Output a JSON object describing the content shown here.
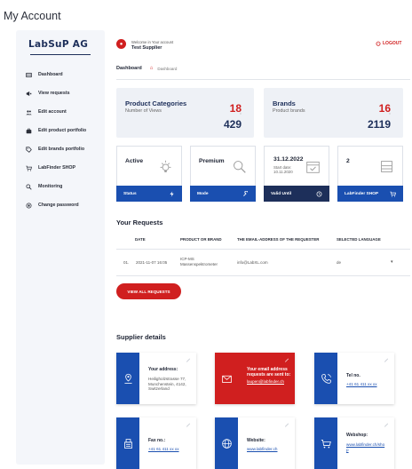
{
  "page": {
    "title": "My Account"
  },
  "brand": {
    "name": "LabSuP AG"
  },
  "sidebar": {
    "items": [
      {
        "label": "Dashboard",
        "icon": "dashboard-icon"
      },
      {
        "label": "View requests",
        "icon": "megaphone-icon"
      },
      {
        "label": "Edit account",
        "icon": "users-icon"
      },
      {
        "label": "Edit product portfolio",
        "icon": "briefcase-icon"
      },
      {
        "label": "Edit brands portfolio",
        "icon": "tag-icon"
      },
      {
        "label": "LabFinder SHOP",
        "icon": "cart-icon"
      },
      {
        "label": "Monitoring",
        "icon": "magnifier-icon"
      },
      {
        "label": "Change password",
        "icon": "key-icon"
      }
    ]
  },
  "header": {
    "welcome": "Welcome in Your account",
    "user": "Test Supplier",
    "logout": "LOGOUT"
  },
  "breadcrumb": {
    "main": "Dashboard",
    "sub": "Dashboard"
  },
  "stats": {
    "categories": {
      "title": "Product Categories",
      "subtitle": "Number of Views",
      "red_value": "18",
      "total": "429"
    },
    "brands": {
      "title": "Brands",
      "subtitle": "Product brands",
      "red_value": "16",
      "total": "2119"
    }
  },
  "status_cards": {
    "status": {
      "value": "Active",
      "bar": "Status"
    },
    "mode": {
      "value": "Premium",
      "bar": "Mode"
    },
    "valid": {
      "value": "31.12.2022",
      "start_label": "Start date:",
      "start_date": "10.11.2020",
      "bar": "Valid Until"
    },
    "shop": {
      "value": "2",
      "bar": "LabFinder SHOP"
    }
  },
  "requests": {
    "title": "Your Requests",
    "columns": [
      "DATE",
      "PRODUCT OR BRAND",
      "THE EMAIL-ADDRESS OF THE REQUESTER",
      "SELECTED LANGUAGE"
    ],
    "rows": [
      {
        "num": "01.",
        "date": "2021-11-07 16:05",
        "product_line1": "ICP-MS",
        "product_line2": "Massenspektrometer",
        "email": "info@LabXL.com",
        "language": "de"
      }
    ],
    "view_all": "VIEW ALL REQUESTS"
  },
  "supplier": {
    "title": "Supplier details",
    "address_label": "Your address:",
    "address_lines": [
      "Heiligholzstrasse 77,",
      "Munchenstein, 4142,",
      "Switzerland"
    ],
    "email_label_lines": [
      "Your email address",
      "requests are sent to:"
    ],
    "email": "laupen@labfinder.ch",
    "tel_label": "Tel no.",
    "tel": "+41 61 411 xx xx",
    "fax_label": "Fax no.:",
    "fax": "+41 61 411 xx xx",
    "website_label": "Website:",
    "website": "www.labfinder.ch",
    "webshop_label": "Webshop:",
    "webshop_lines": [
      "www.labfinder.ch/sho",
      "p"
    ]
  },
  "colors": {
    "accent": "#d01f1f",
    "primary": "#1a4fb0",
    "navy": "#1d2f5a",
    "card_bg": "#eef1f6"
  }
}
